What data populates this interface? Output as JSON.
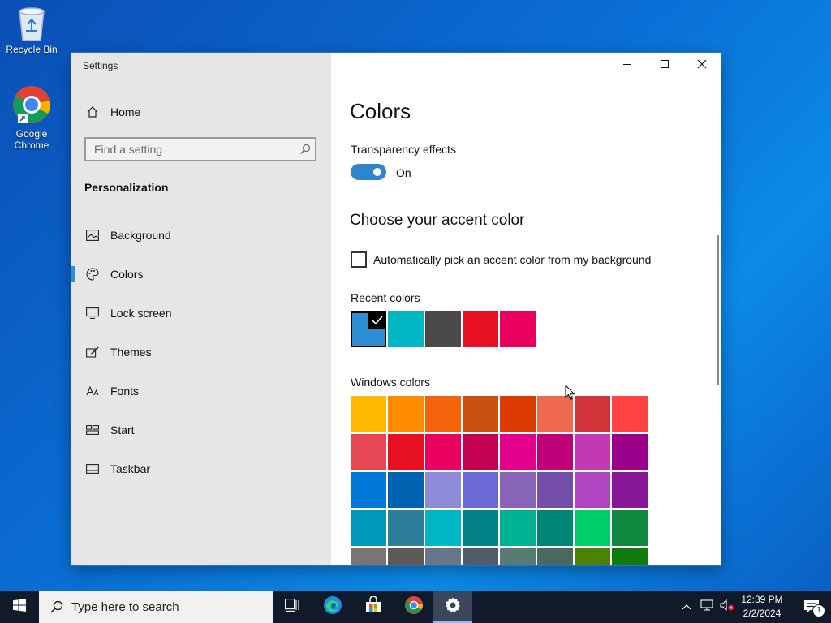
{
  "desktop": {
    "icons": [
      {
        "label": "Recycle Bin"
      },
      {
        "label": "Google Chrome"
      }
    ]
  },
  "window": {
    "title": "Settings",
    "controls": {
      "minimize": "minimize",
      "maximize": "maximize",
      "close": "close"
    }
  },
  "sidebar": {
    "home_label": "Home",
    "search_placeholder": "Find a setting",
    "section": "Personalization",
    "items": [
      {
        "label": "Background",
        "icon": "picture-icon"
      },
      {
        "label": "Colors",
        "icon": "palette-icon",
        "active": true
      },
      {
        "label": "Lock screen",
        "icon": "lock-screen-icon"
      },
      {
        "label": "Themes",
        "icon": "themes-icon"
      },
      {
        "label": "Fonts",
        "icon": "fonts-icon"
      },
      {
        "label": "Start",
        "icon": "start-icon"
      },
      {
        "label": "Taskbar",
        "icon": "taskbar-icon"
      }
    ]
  },
  "main": {
    "title": "Colors",
    "transparency_label": "Transparency effects",
    "transparency_state": "On",
    "accent_heading": "Choose your accent color",
    "auto_pick_label": "Automatically pick an accent color from my background",
    "recent_label": "Recent colors",
    "recent_colors": [
      "#2d8ed1",
      "#00b7c3",
      "#4c4a48",
      "#e81123",
      "#ea005e"
    ],
    "windows_label": "Windows colors",
    "windows_colors": [
      [
        "#ffb900",
        "#ff8c00",
        "#f7630c",
        "#ca5010",
        "#da3b01",
        "#ef6950",
        "#d13438",
        "#ff4343"
      ],
      [
        "#e74856",
        "#e81123",
        "#ea005e",
        "#c30052",
        "#e3008c",
        "#bf0077",
        "#c239b3",
        "#9a0089"
      ],
      [
        "#0078d7",
        "#0063b1",
        "#8e8cd8",
        "#6b69d6",
        "#8764b8",
        "#744da9",
        "#b146c2",
        "#881798"
      ],
      [
        "#0099bc",
        "#2d7d9a",
        "#00b7c3",
        "#038387",
        "#00b294",
        "#018574",
        "#00cc6a",
        "#10893e"
      ],
      [
        "#7a7574",
        "#5d5a58",
        "#68768a",
        "#515c6b",
        "#567c73",
        "#486860",
        "#498205",
        "#107c10"
      ]
    ]
  },
  "taskbar": {
    "search_placeholder": "Type here to search",
    "time": "12:39 PM",
    "date": "2/2/2024",
    "notification_count": "1"
  }
}
